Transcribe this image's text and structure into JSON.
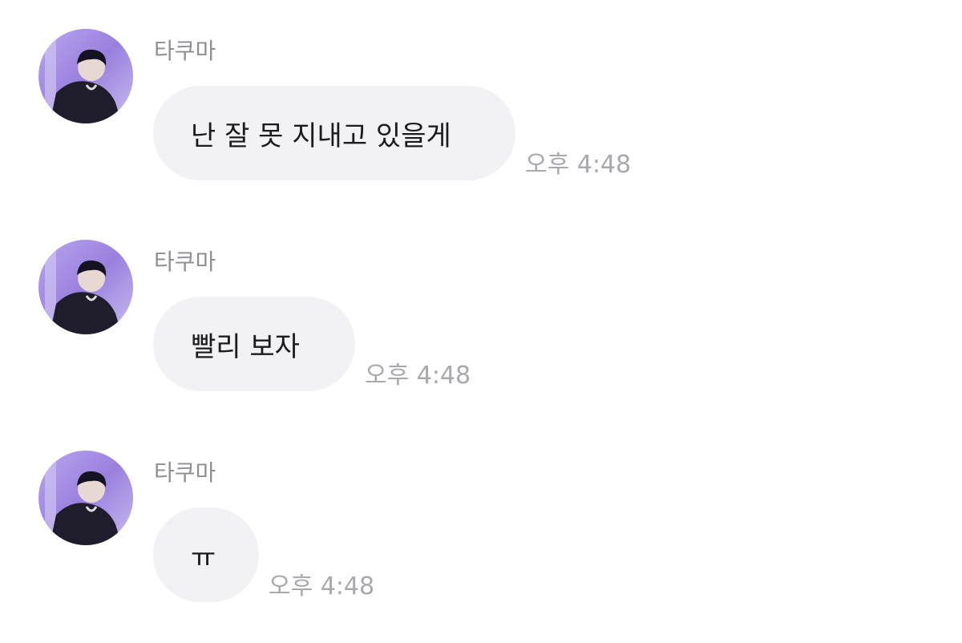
{
  "messages": [
    {
      "sender": "타쿠마",
      "text": "난 잘 못 지내고 있을게",
      "time": "오후 4:48"
    },
    {
      "sender": "타쿠마",
      "text": "빨리 보자",
      "time": "오후 4:48"
    },
    {
      "sender": "타쿠마",
      "text": "ㅠ",
      "time": "오후 4:48"
    }
  ],
  "colors": {
    "bubble": "#f2f2f4",
    "sender": "#8e8e93",
    "time": "#a8a8ae",
    "text": "#1c1c1e",
    "avatar_bg": "#a48fe0"
  },
  "icons": {
    "avatar": "profile-photo-avatar"
  }
}
